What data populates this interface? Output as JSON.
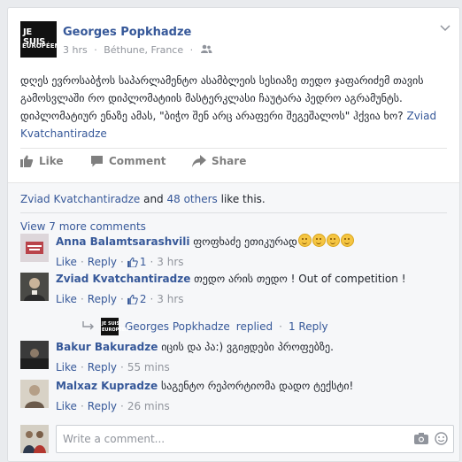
{
  "post": {
    "author": "Georges Popkhadze",
    "avatar_text_1": "JE SUIS",
    "avatar_text_2": "EUROPÉEN",
    "time": "3 hrs",
    "location": "Béthune, France",
    "text": "დღეს ევროსაბჭოს საპარლამენტო ასამბლეის სესიაზე თედო ჯაფარიძემ თავის გამოსვლაში რო დიპლომატიის მასტერკლასი ჩაუტარა პედრო აგრამუნტს. დიპლომატიურ ენაზე ამას, \"ბიჭო შენ არც არაფერი შეგეშალოს\" ჰქვია ხო?",
    "mention": "Zviad Kvatchantiradze"
  },
  "actions": {
    "like": "Like",
    "comment": "Comment",
    "share": "Share"
  },
  "likes": {
    "name": "Zviad Kvatchantiradze",
    "and": "and",
    "others": "48 others",
    "suffix": "like this."
  },
  "view_more": "View 7 more comments",
  "comments": [
    {
      "name": "Anna Balamtsarashvili",
      "text": "ფოფხაძე ეთიკურად",
      "like": "Like",
      "reply": "Reply",
      "likes": "1",
      "time": "3 hrs"
    },
    {
      "name": "Zviad Kvatchantiradze",
      "text": "თედო არის თედო ! Out of competition !",
      "like": "Like",
      "reply": "Reply",
      "likes": "2",
      "time": "3 hrs"
    },
    {
      "name": "Bakur Bakuradze",
      "text": "იცის და პა:) ვგიჟდები პროფებზე.",
      "like": "Like",
      "reply": "Reply",
      "time": "55 mins"
    },
    {
      "name": "Malxaz Kupradze",
      "text": "საგენტო რეპორტიომა დადო ტექსტი!",
      "like": "Like",
      "reply": "Reply",
      "time": "26 mins"
    }
  ],
  "reply_summary": {
    "name": "Georges Popkhadze",
    "verb": "replied",
    "count": "1 Reply"
  },
  "write_comment": {
    "placeholder": "Write a comment..."
  }
}
